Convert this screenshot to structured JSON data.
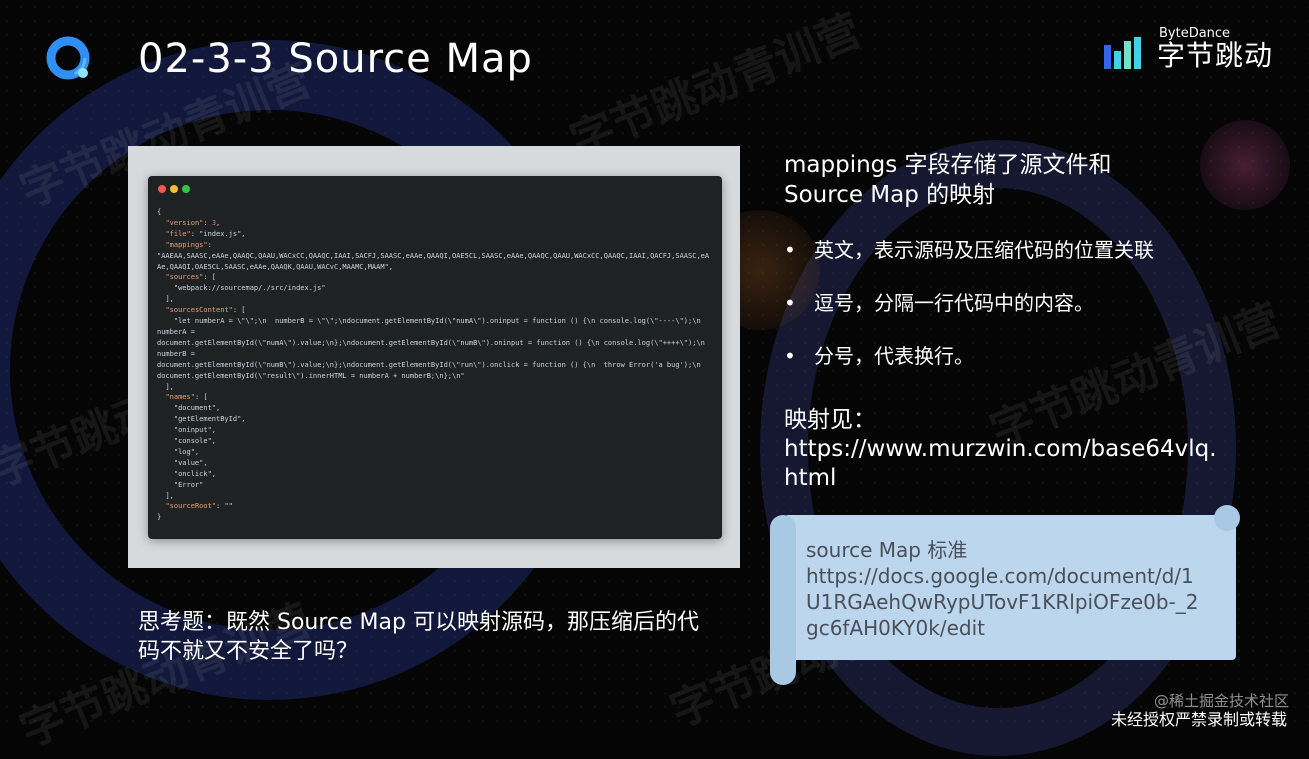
{
  "slide": {
    "title": "02-3-3 Source Map",
    "brand_en": "ByteDance",
    "brand_cn": "字节跳动",
    "watermark_text": "字节跳动青训营"
  },
  "code_sample": {
    "lines": [
      "{",
      "  \"version\": 3,",
      "  \"file\": \"index.js\",",
      "  \"mappings\":",
      "\"AAEAA,SAASC,eAAe,QAAQC,QAAU,WACxCC,QAAQC,IAAI,SACFJ,SAASC,eAAe,QAAQI,OAE5CL,SAASC,eAAe,QAAQC,QAAU,WACxCC,QAAQC,IAAI,QACFJ,SAASC,eAAe,QAAQI,OAE5CL,SAASC,eAAe,QAAQK,QAAU,WACvC,MAAMC,MAAM\",",
      "  \"sources\": [",
      "    \"webpack://sourcemap/./src/index.js\"",
      "  ],",
      "  \"sourcesContent\": [",
      "    \"let numberA = \\\"\\\";\\n  numberB = \\\"\\\";\\ndocument.getElementById(\\\"numA\\\").oninput = function () {\\n console.log(\\\"----\\\");\\n  numberA =",
      "document.getElementById(\\\"numA\\\").value;\\n};\\ndocument.getElementById(\\\"numB\\\").oninput = function () {\\n console.log(\\\"++++\\\");\\n  numberB =",
      "document.getElementById(\\\"numB\\\").value;\\n};\\ndocument.getElementById(\\\"run\\\").onclick = function () {\\n  throw Error('a bug');\\n  document.getElementById(\\\"result\\\").innerHTML = numberA + numberB;\\n};\\n\"",
      "  ],",
      "  \"names\": [",
      "    \"document\",",
      "    \"getElementById\",",
      "    \"oninput\",",
      "    \"console\",",
      "    \"log\",",
      "    \"value\",",
      "    \"onclick\",",
      "    \"Error\"",
      "  ],",
      "  \"sourceRoot\": \"\"",
      "}"
    ]
  },
  "content": {
    "heading": "mappings 字段存储了源文件和\nSource Map 的映射",
    "bullets": [
      {
        "marker": "•",
        "text": "英文，表示源码及压缩代码的位置关联"
      },
      {
        "marker": "•",
        "text": "逗号，分隔一行代码中的内容。"
      },
      {
        "marker": "•",
        "text": "分号，代表换行。"
      }
    ],
    "ref_label": "映射见：",
    "ref_url": "https://www.murzwin.com/base64vlq.html"
  },
  "note_card": {
    "title": "source Map 标准",
    "url": "https://docs.google.com/document/d/1U1RGAehQwRypUTovF1KRlpiOFze0b-_2gc6fAH0KY0k/edit"
  },
  "question": "思考题：既然 Source Map 可以映射源码，那压缩后的代码不就又不安全了吗？",
  "footer": {
    "juejin": "@稀土掘金技术社区",
    "note": "未经授权严禁录制或转载"
  },
  "colors": {
    "background": "#050505",
    "code_bg": "#1f2223",
    "code_frame": "#d7dadc",
    "note_card": "#bcd6ee",
    "logo_blue": "#2f8ff2",
    "brand_cyan": "#3fd3e6"
  }
}
